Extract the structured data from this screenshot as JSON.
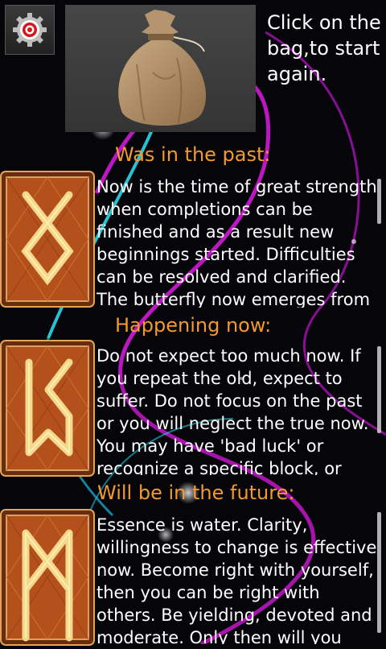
{
  "header": {
    "hint_text": "Click on the bag,to start again."
  },
  "icons": {
    "settings": "gear-target-icon",
    "bag": "burlap-sack-icon"
  },
  "colors": {
    "title_orange": "#f39a2e",
    "text_white": "#ffffff",
    "card_orange": "#b4501c",
    "rune_gold": "#f4d98a",
    "swirl_magenta": "#d01ad6",
    "swirl_cyan": "#2ad8e8"
  },
  "sections": [
    {
      "title": "Was in the past:",
      "rune": "othala-rune",
      "text": "Now is the time of great strength when completions can be finished and as a result new beginnings started. Difficulties can be resolved and clarified. The butterfly now emerges from"
    },
    {
      "title": "Happening now:",
      "rune": "perthro-rune",
      "text": "Do not expect too much now. If you repeat the old, expect to suffer. Do not focus on the past or you will neglect the true now. You may have 'bad luck' or recognize a specific block, or"
    },
    {
      "title": "Will be in the future:",
      "rune": "mannaz-rune",
      "text": "Essence is water. Clarity, willingness to change is effective now. Become right with yourself, then you can be right with others. Be yielding, devoted and moderate. Only then will you"
    }
  ]
}
